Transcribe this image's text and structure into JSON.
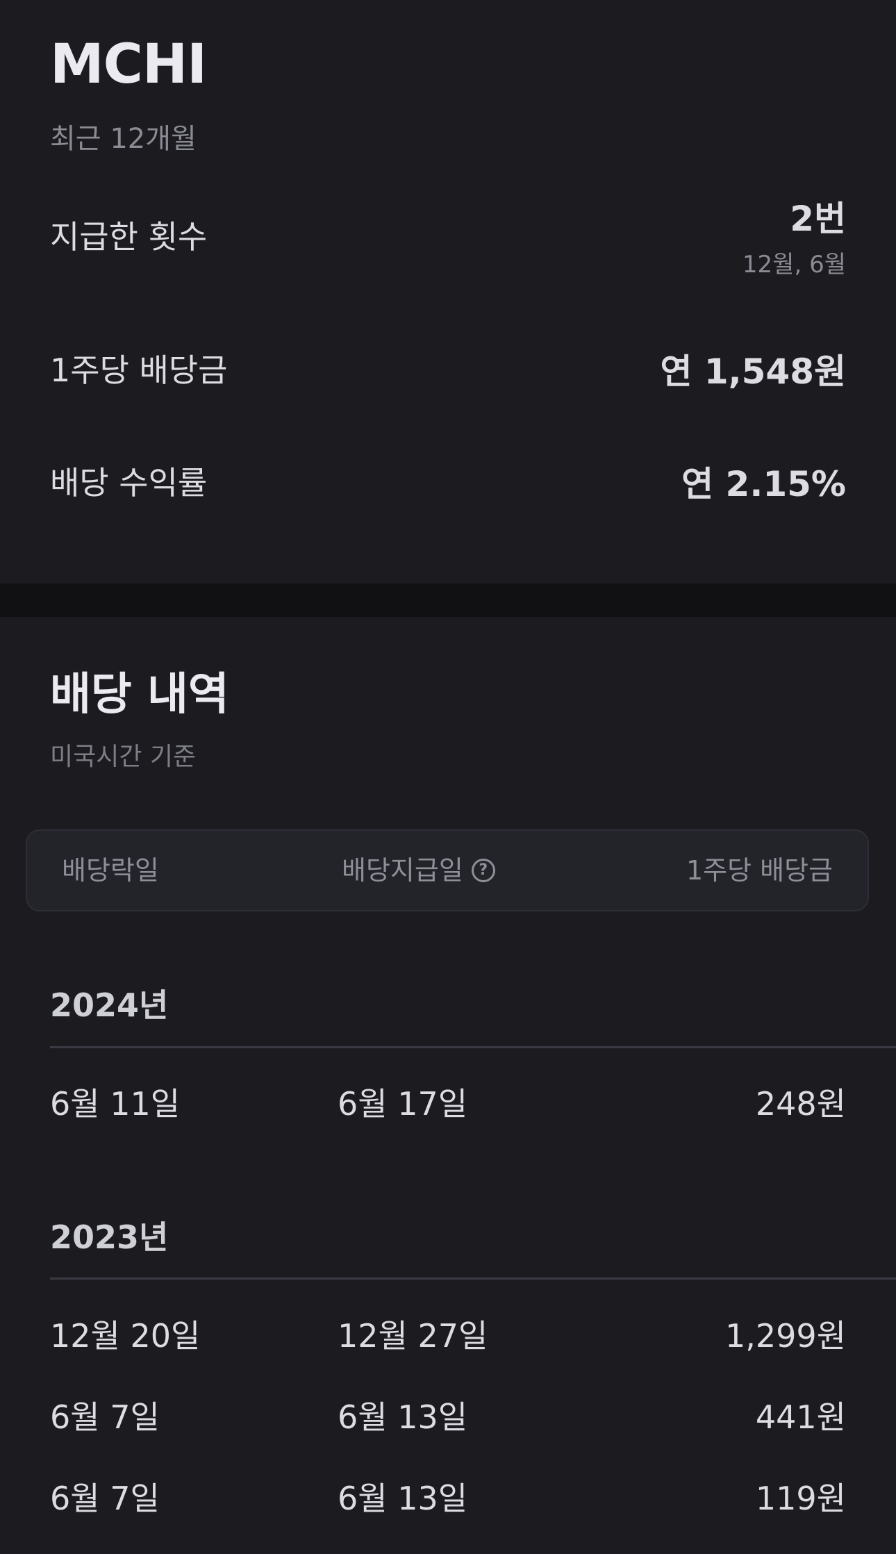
{
  "summary": {
    "ticker": "MCHI",
    "period": "최근 12개월",
    "stats": [
      {
        "label": "지급한 횟수",
        "value": "2번",
        "sub": "12월, 6월"
      },
      {
        "label": "1주당 배당금",
        "value": "연 1,548원"
      },
      {
        "label": "배당 수익률",
        "value": "연 2.15%"
      }
    ]
  },
  "history": {
    "title": "배당 내역",
    "subtitle": "미국시간 기준",
    "columns": {
      "ex_date": "배당락일",
      "pay_date": "배당지급일",
      "help_icon": "?",
      "amount": "1주당 배당금"
    },
    "years": [
      {
        "year": "2024년",
        "rows": [
          {
            "ex_date": "6월 11일",
            "pay_date": "6월 17일",
            "amount": "248원"
          }
        ]
      },
      {
        "year": "2023년",
        "rows": [
          {
            "ex_date": "12월 20일",
            "pay_date": "12월 27일",
            "amount": "1,299원"
          },
          {
            "ex_date": "6월 7일",
            "pay_date": "6월 13일",
            "amount": "441원"
          },
          {
            "ex_date": "6월 7일",
            "pay_date": "6월 13일",
            "amount": "119원"
          }
        ]
      }
    ]
  },
  "colors": {
    "background": "#1b1b20",
    "divider_band": "#111114",
    "header_bg": "#23232a",
    "primary_text": "#eaeaf0",
    "secondary_text": "#8b8b94"
  }
}
